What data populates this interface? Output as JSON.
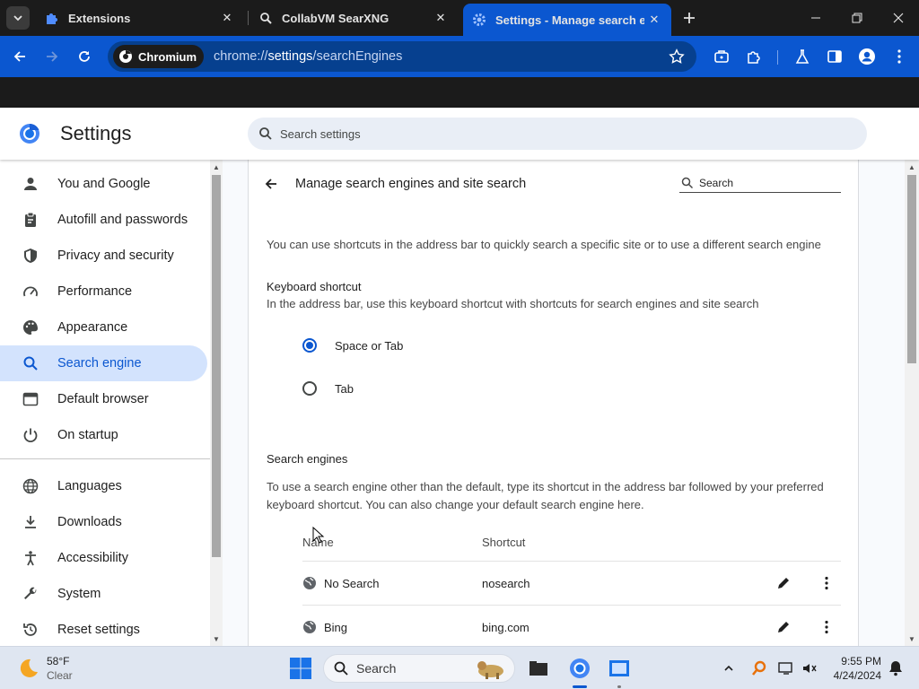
{
  "browser": {
    "tabs": [
      {
        "title": "Extensions",
        "icon": "puzzle-icon",
        "active": false
      },
      {
        "title": "CollabVM SearXNG",
        "icon": "searxng-icon",
        "active": false
      },
      {
        "title": "Settings - Manage search engi",
        "icon": "gear-icon",
        "active": true
      }
    ],
    "site_chip": "Chromium",
    "url_prefix": "chrome://",
    "url_host": "settings",
    "url_path": "/searchEngines",
    "accent": "#0b57d0"
  },
  "settings": {
    "title": "Settings",
    "search_placeholder": "Search settings",
    "nav": [
      {
        "label": "You and Google",
        "icon": "person-icon"
      },
      {
        "label": "Autofill and passwords",
        "icon": "clipboard-icon"
      },
      {
        "label": "Privacy and security",
        "icon": "shield-icon"
      },
      {
        "label": "Performance",
        "icon": "speedometer-icon"
      },
      {
        "label": "Appearance",
        "icon": "palette-icon"
      },
      {
        "label": "Search engine",
        "icon": "search-icon",
        "selected": true
      },
      {
        "label": "Default browser",
        "icon": "browser-icon"
      },
      {
        "label": "On startup",
        "icon": "power-icon"
      },
      {
        "label": "Languages",
        "icon": "globe-icon"
      },
      {
        "label": "Downloads",
        "icon": "download-icon"
      },
      {
        "label": "Accessibility",
        "icon": "accessibility-icon"
      },
      {
        "label": "System",
        "icon": "wrench-icon"
      },
      {
        "label": "Reset settings",
        "icon": "reset-icon"
      }
    ]
  },
  "page": {
    "title": "Manage search engines and site search",
    "search_placeholder": "Search",
    "intro": "You can use shortcuts in the address bar to quickly search a specific site or to use a different search engine",
    "keyboard_heading": "Keyboard shortcut",
    "keyboard_desc": "In the address bar, use this keyboard shortcut with shortcuts for search engines and site search",
    "radio_options": [
      {
        "label": "Space or Tab",
        "checked": true
      },
      {
        "label": "Tab",
        "checked": false
      }
    ],
    "engines_heading": "Search engines",
    "engines_desc_line1": "To use a search engine other than the default, type its shortcut in the address bar followed by your preferred",
    "engines_desc_line2": "keyboard shortcut. You can also change your default search engine here.",
    "col_name": "Name",
    "col_shortcut": "Shortcut",
    "engines": [
      {
        "name": "No Search",
        "shortcut": "nosearch"
      },
      {
        "name": "Bing",
        "shortcut": "bing.com"
      }
    ]
  },
  "taskbar": {
    "temperature": "58°F",
    "condition": "Clear",
    "search_label": "Search",
    "time": "9:55 PM",
    "date": "4/24/2024"
  }
}
